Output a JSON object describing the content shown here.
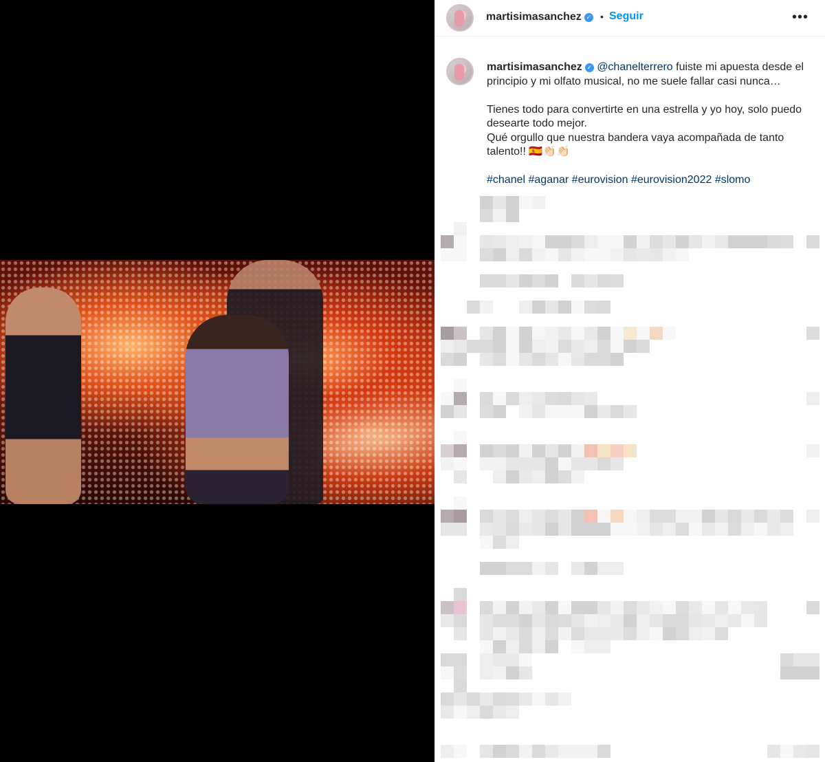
{
  "post": {
    "username": "martisimasanchez",
    "verified_mark": "✓",
    "header_dot": "•",
    "follow_label": "Seguir",
    "more_label": "•••"
  },
  "caption": {
    "username": "martisimasanchez",
    "mention": "@chanelterrero",
    "line1_rest": " fuiste mi apuesta desde el principio y mi olfato musical, no me suele fallar casi nunca…",
    "line2": "Tienes todo para convertirte en una estrella y yo hoy, solo puedo desearte todo mejor.",
    "line3": "Qué orgullo que nuestra bandera vaya acompañada de tanto talento!! 🇪🇸👏🏻👏🏻",
    "hashtags": [
      "#chanel",
      "#aganar",
      "#eurovision",
      "#eurovision2022",
      "#slomo"
    ]
  },
  "colors": {
    "link_blue": "#0095f6",
    "hashtag_blue": "#00376b",
    "verified_blue": "#3897f0",
    "text": "#262626"
  },
  "icons": {
    "verified": "verified-badge-icon",
    "more": "more-options-icon"
  }
}
